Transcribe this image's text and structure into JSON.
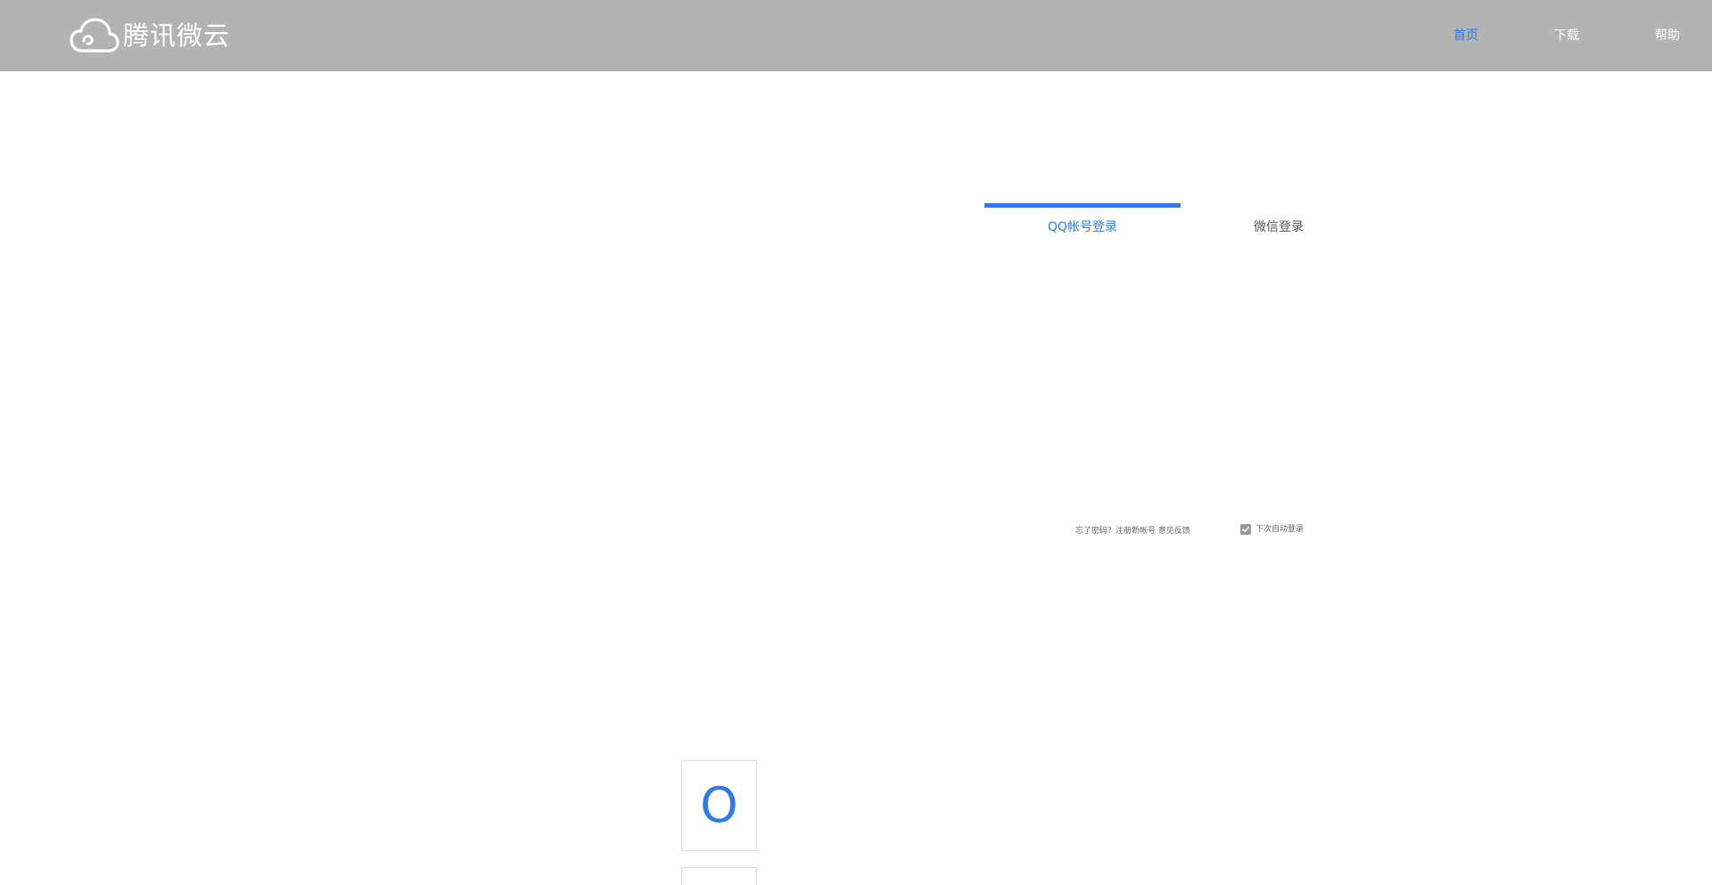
{
  "header": {
    "logo_text": "腾讯微云",
    "logo_icon": "cloud-icon",
    "nav": [
      {
        "label": "首页",
        "active": true
      },
      {
        "label": "下载",
        "active": false
      },
      {
        "label": "帮助",
        "active": false
      }
    ]
  },
  "login": {
    "tabs": [
      {
        "label": "QQ帐号登录",
        "active": true
      },
      {
        "label": "微信登录",
        "active": false
      }
    ],
    "footer": {
      "link_text": "忘了密码？注册新帐号 意见反馈",
      "remember_label": "下次自动登录",
      "remember_checked": true
    }
  },
  "cards": [
    {
      "glyph": "O"
    },
    {
      "glyph": ""
    }
  ],
  "colors": {
    "header_bg": "#b3b3b3",
    "accent": "#2f7be6"
  }
}
